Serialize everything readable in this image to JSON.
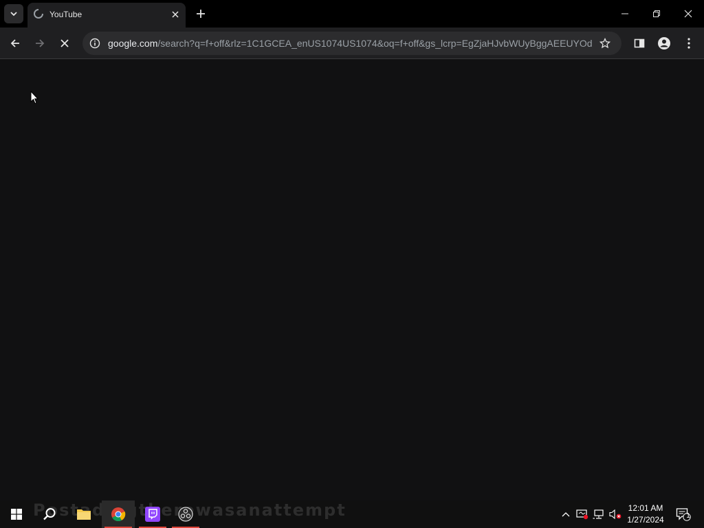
{
  "tab": {
    "title": "YouTube"
  },
  "address_bar": {
    "host": "google.com",
    "path": "/search?q=f+off&rlz=1C1GCEA_enUS1074US1074&oq=f+off&gs_lcrp=EgZjaHJvbWUyBggAEEUYOdI..."
  },
  "icons": {
    "tab_list": "chevron-down-icon",
    "favicon": "loading-spinner-icon",
    "tab_close": "close-icon",
    "new_tab": "plus-icon",
    "back": "arrow-left-icon",
    "forward": "arrow-right-icon",
    "stop": "close-icon",
    "site_info": "info-icon",
    "bookmark": "star-icon",
    "side_panel": "side-panel-icon",
    "profile": "person-icon",
    "menu": "kebab-menu-icon"
  },
  "taskbar": {
    "watermark": "Postadingtherewasanattempt",
    "time": "12:01 AM",
    "date": "1/27/2024",
    "notification_count": "1"
  },
  "colors": {
    "accent": "#8ab4f8",
    "page_background": "#111112"
  }
}
